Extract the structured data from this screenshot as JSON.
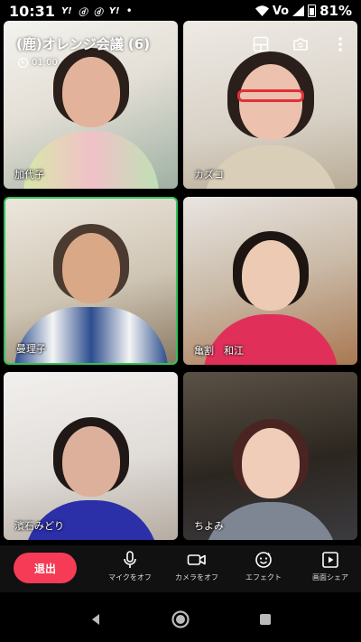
{
  "status_bar": {
    "time": "10:31",
    "app_icons": [
      "Y!",
      "ⓓ",
      "ⓓ",
      "Y!"
    ],
    "dot": "•",
    "network": "Vo",
    "battery": "81%"
  },
  "call": {
    "title": "(鹿)オレンジ会議 (6)",
    "duration": "01:00"
  },
  "participants": [
    {
      "name": "加代子",
      "active": false
    },
    {
      "name": "カズコ",
      "active": false
    },
    {
      "name": "曼理子",
      "active": true
    },
    {
      "name": "亀割　和江",
      "active": false
    },
    {
      "name": "濱石みどり",
      "active": false
    },
    {
      "name": "ちよみ",
      "active": false
    }
  ],
  "toolbar": {
    "leave_label": "退出",
    "mic_label": "マイクをオフ",
    "camera_label": "カメラをオフ",
    "effect_label": "エフェクト",
    "share_label": "画面シェア"
  },
  "colors": {
    "leave": "#f53b55",
    "active_border": "#33c25a"
  }
}
